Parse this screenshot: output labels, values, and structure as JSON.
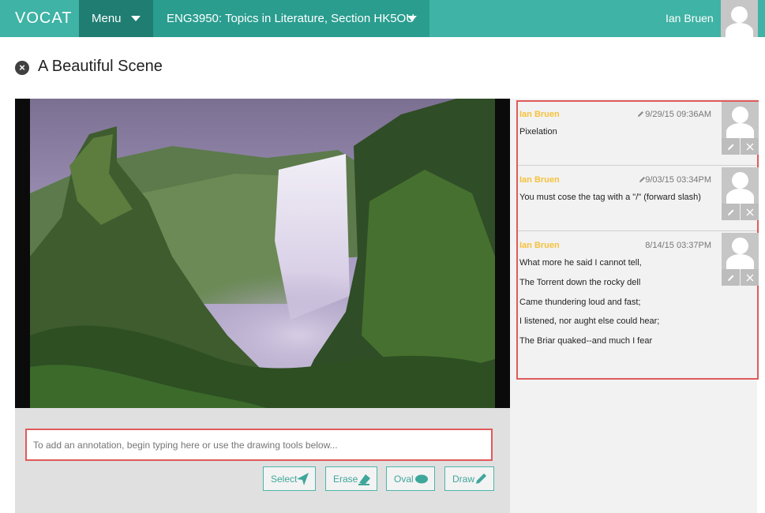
{
  "header": {
    "logo": "VOCAT",
    "menu_label": "Menu",
    "course_label": "ENG3950: Topics in Literature, Section HK5OU",
    "user_name": "Ian Bruen"
  },
  "page": {
    "title": "A Beautiful Scene"
  },
  "annotation_input": {
    "placeholder": "To add an annotation, begin typing here or use the drawing tools below...",
    "value": ""
  },
  "tools": [
    {
      "label": "Select",
      "icon": "cursor-arrow-icon"
    },
    {
      "label": "Erase",
      "icon": "eraser-icon"
    },
    {
      "label": "Oval",
      "icon": "oval-icon"
    },
    {
      "label": "Draw",
      "icon": "pencil-icon"
    }
  ],
  "annotations": [
    {
      "author": "Ian Bruen",
      "time": "9/29/15 09:36AM",
      "edited": true,
      "lines": [
        "Pixelation"
      ]
    },
    {
      "author": "Ian Bruen",
      "time": "9/03/15 03:34PM",
      "edited": true,
      "lines": [
        "You must cose the tag with a \"/\" (forward slash)"
      ]
    },
    {
      "author": "Ian Bruen",
      "time": "8/14/15 03:37PM",
      "edited": false,
      "lines": [
        "What more he said I cannot tell,",
        "The Torrent down the rocky dell",
        "Came thundering loud and fast;",
        "I listened, nor aught else could hear;",
        "The Briar quaked--and much I fear"
      ]
    }
  ],
  "colors": {
    "brand": "#3fb3a5",
    "menu_dark": "#1f7d72",
    "author": "#f5c13d",
    "highlight": "#e05a5a"
  }
}
